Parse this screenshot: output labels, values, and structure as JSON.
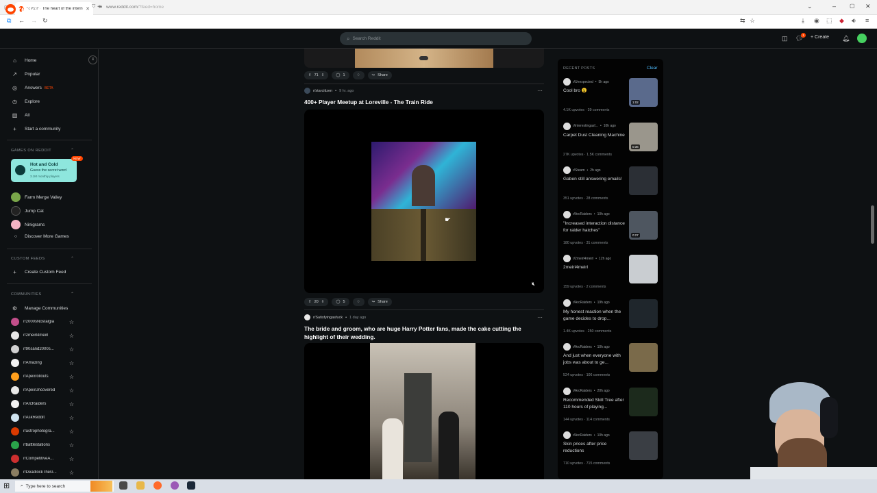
{
  "browser": {
    "tab_title": "Reddit - The heart of the internet",
    "new_tab_icon": "plus-icon",
    "url_prefix": "www.reddit.com",
    "url_path": "/?feed=home",
    "window_controls": [
      "minimize-icon",
      "maximize-icon",
      "close-icon"
    ]
  },
  "header": {
    "logo_text": "reddit",
    "search_placeholder": "Search Reddit",
    "create_label": "Create",
    "notif_count": "1"
  },
  "sidebar": {
    "nav": [
      {
        "icon": "home-icon",
        "glyph": "⌂",
        "label": "Home"
      },
      {
        "icon": "popular-icon",
        "glyph": "↗",
        "label": "Popular"
      },
      {
        "icon": "answers-icon",
        "glyph": "◎",
        "label": "Answers",
        "badge": "BETA"
      },
      {
        "icon": "explore-icon",
        "glyph": "◷",
        "label": "Explore"
      },
      {
        "icon": "all-icon",
        "glyph": "▥",
        "label": "All"
      },
      {
        "icon": "plus-icon",
        "glyph": "+",
        "label": "Start a community"
      }
    ],
    "games_header": "GAMES ON REDDIT",
    "featured_game": {
      "title": "Hot and Cold",
      "subtitle": "Guess the secret word",
      "players": "3.1M monthly players",
      "badge": "NEW"
    },
    "games": [
      "Farm Merge Valley",
      "Jump Cat",
      "Ninigrams",
      "Discover More Games"
    ],
    "custom_header": "CUSTOM FEEDS",
    "create_custom_feed": "Create Custom Feed",
    "communities_header": "COMMUNITIES",
    "manage": "Manage Communities",
    "communities": [
      {
        "name": "r/2000sNostalgia",
        "color": "#c24e8a"
      },
      {
        "name": "r/2meirl4meirl",
        "color": "#e7e7e7"
      },
      {
        "name": "r/90sand2000s...",
        "color": "#d0d0d0"
      },
      {
        "name": "r/Amazing",
        "color": "#f2f2f2"
      },
      {
        "name": "r/Apexrollouts",
        "color": "#ff9f1c"
      },
      {
        "name": "r/ApexUncovered",
        "color": "#e8e8e8"
      },
      {
        "name": "r/ArcRaiders",
        "color": "#f3f3f3"
      },
      {
        "name": "r/AskReddit",
        "color": "#cfe3f0"
      },
      {
        "name": "r/astrophotogra...",
        "color": "#d93a00"
      },
      {
        "name": "r/battlestations",
        "color": "#2aa44a"
      },
      {
        "name": "r/CompetitiveA...",
        "color": "#cc2f2f"
      },
      {
        "name": "r/DeadlockTheG...",
        "color": "#8a7d61"
      }
    ]
  },
  "feed": {
    "post0": {
      "votes": "71",
      "comments": "1",
      "share": "Share"
    },
    "post1": {
      "subreddit": "r/starcitizen",
      "time": "9 hr. ago",
      "title": "400+ Player Meetup at Loreville - The Train Ride",
      "votes": "20",
      "comments": "5",
      "share": "Share"
    },
    "post2": {
      "subreddit": "r/Satisfyingasfuck",
      "time": "1 day ago",
      "title": "The bride and groom, who are huge Harry Potter fans, made the cake cutting the highlight of their wedding."
    }
  },
  "recent": {
    "header": "RECENT POSTS",
    "clear": "Clear",
    "items": [
      {
        "sub": "r/Unexpected",
        "time": "5h ago",
        "title": "Cool bro 😮",
        "upvotes": "4.1K upvotes",
        "comments": "39 comments",
        "dur": "1:02",
        "thumb": "#5a6a8c"
      },
      {
        "sub": "r/interestingasf...",
        "time": "10h ago",
        "title": "Carpet Dust Cleaning Machine",
        "upvotes": "27K upvotes",
        "comments": "1.5K comments",
        "dur": "0:36",
        "thumb": "#9a968c"
      },
      {
        "sub": "r/Steam",
        "time": "2h ago",
        "title": "Gaben still answering emails!",
        "upvotes": "351 upvotes",
        "comments": "28 comments",
        "dur": "",
        "thumb": "#2b2f35"
      },
      {
        "sub": "r/ArcRaiders",
        "time": "10h ago",
        "title": "\"Increased interaction distance for raider hatches\"",
        "upvotes": "180 upvotes",
        "comments": "31 comments",
        "dur": "0:27",
        "thumb": "#4e5660"
      },
      {
        "sub": "r/2meirl4meirl",
        "time": "12h ago",
        "title": "2meirl4meirl",
        "upvotes": "159 upvotes",
        "comments": "2 comments",
        "dur": "",
        "thumb": "#c9cdd1"
      },
      {
        "sub": "r/ArcRaiders",
        "time": "19h ago",
        "title": "My honest reaction when the game decides to drop...",
        "upvotes": "1.4K upvotes",
        "comments": "250 comments",
        "dur": "",
        "thumb": "#1f262c"
      },
      {
        "sub": "r/ArcRaiders",
        "time": "10h ago",
        "title": "And just when everyone with jobs was about to ge...",
        "upvotes": "524 upvotes",
        "comments": "106 comments",
        "dur": "",
        "thumb": "#7a6a4a"
      },
      {
        "sub": "r/ArcRaiders",
        "time": "20h ago",
        "title": "Recommended Skill Tree after 110 hours of playing...",
        "upvotes": "144 upvotes",
        "comments": "114 comments",
        "dur": "",
        "thumb": "#1c2a1c"
      },
      {
        "sub": "r/ArcRaiders",
        "time": "10h ago",
        "title": "Skin prices after price reductions",
        "upvotes": "710 upvotes",
        "comments": "715 comments",
        "dur": "",
        "thumb": "#3a3e44"
      }
    ]
  },
  "taskbar": {
    "search_placeholder": "Type here to search"
  }
}
